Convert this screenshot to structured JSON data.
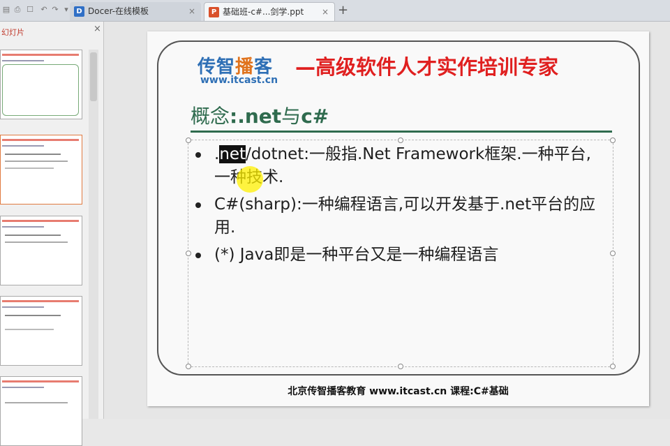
{
  "tabs": [
    {
      "label": "Docer-在线模板",
      "icon": "docer-icon",
      "color": "#2f6fc6"
    },
    {
      "label": "基础班-c#...剑学.ppt",
      "icon": "ppt-icon",
      "color": "#d9502a"
    }
  ],
  "panel": {
    "title": "幻灯片"
  },
  "slide": {
    "logo_part1": "传智",
    "logo_part2": "播",
    "logo_part3": "客",
    "logo_url": "www.itcast.cn",
    "slogan": "—高级软件人才实作培训专家",
    "heading_part1": "概念",
    "heading_part2": ":.net",
    "heading_part3": "与",
    "heading_part4": "c#",
    "bullet1_selected": "net",
    "bullet1_prefix": ".",
    "bullet1_rest": "/dotnet:一般指.Net Framework框架.一种平台,一种技术.",
    "bullet2": "C#(sharp):一种编程语言,可以开发基于.net平台的应用.",
    "bullet3": "(*) Java即是一种平台又是一种编程语言",
    "footer": "北京传智播客教育 www.itcast.cn       课程:C#基础"
  },
  "colors": {
    "accent_red": "#e02020",
    "brand_blue": "#2e6fb5",
    "heading_green": "#2f6b4e"
  }
}
